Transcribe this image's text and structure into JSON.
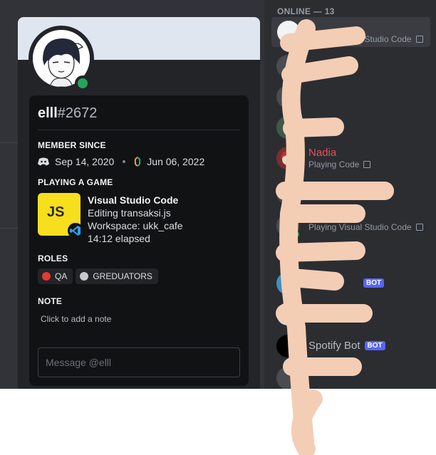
{
  "profile": {
    "username": "elll",
    "discriminator": "#2672",
    "member_since": {
      "title": "MEMBER SINCE",
      "discord_date": "Sep 14, 2020",
      "server_date": "Jun 06, 2022"
    },
    "activity": {
      "title": "PLAYING A GAME",
      "app_name": "Visual Studio Code",
      "details": "Editing transaksi.js",
      "state": "Workspace: ukk_cafe",
      "elapsed": "14:12 elapsed",
      "icon_text": "JS"
    },
    "roles": {
      "title": "ROLES",
      "items": [
        {
          "label": "QA",
          "color": "#e53935"
        },
        {
          "label": "GREDUATORS",
          "color": "#c4c9ce"
        }
      ]
    },
    "note": {
      "title": "NOTE",
      "hint": "Click to add a note"
    },
    "message_placeholder": "Message @elll"
  },
  "member_list": {
    "header": "ONLINE — 13",
    "members": [
      {
        "name": "",
        "activity": "Playing Visual Studio Code",
        "highlighted": true
      },
      {
        "name": "Nadia",
        "activity": "Playing Code",
        "name_color": "#e1525b"
      },
      {
        "name": "",
        "activity": "Playing Visual Studio Code"
      },
      {
        "name": "Spotify Bot",
        "bot_tag": "BOT"
      },
      {
        "name": "",
        "bot_tag": "BOT"
      }
    ]
  },
  "colors": {
    "background": "#313338",
    "sidebar": "#2b2d31",
    "card": "#111214",
    "online": "#23a55a",
    "bot_tag": "#5865f2",
    "scribble": "#f4cdb5"
  }
}
